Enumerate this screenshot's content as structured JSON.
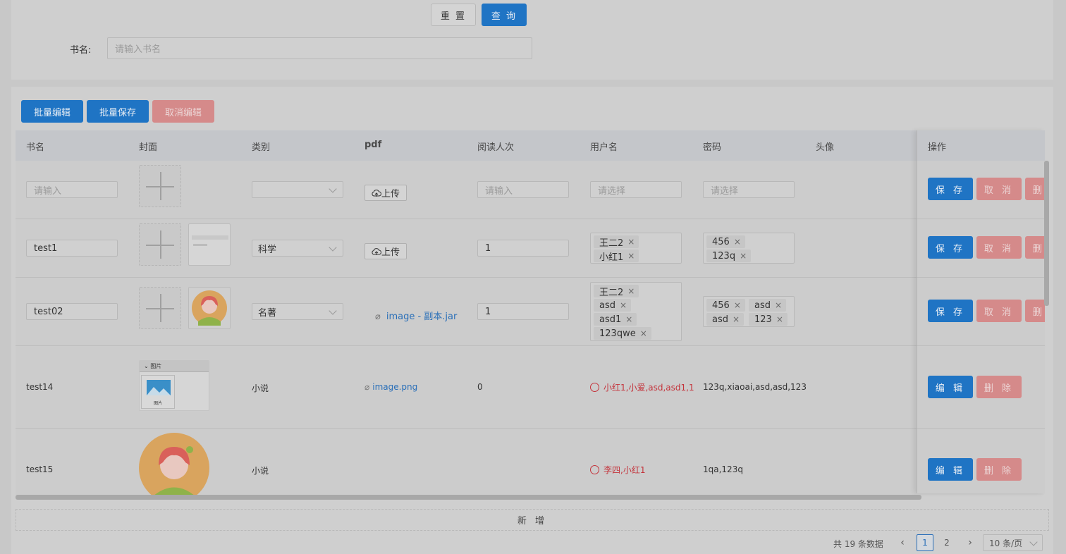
{
  "search": {
    "reset_label": "重 置",
    "query_label": "查 询",
    "book_name_label": "书名:",
    "book_name_placeholder": "请输入书名"
  },
  "toolbar": {
    "batch_edit": "批量编辑",
    "batch_save": "批量保存",
    "cancel_edit": "取消编辑"
  },
  "table": {
    "columns": [
      "书名",
      "封面",
      "类别",
      "pdf",
      "阅读人次",
      "用户名",
      "密码",
      "头像",
      "操作"
    ],
    "new_row": {
      "name_placeholder": "请输入",
      "upload_label": "上传",
      "reads_placeholder": "请输入",
      "user_placeholder": "请选择",
      "pwd_placeholder": "请选择"
    },
    "rows": [
      {
        "name": "test1",
        "category": "科学",
        "upload_label": "上传",
        "reads": "1",
        "users": [
          "王二2",
          "小红1"
        ],
        "passwords": [
          "456",
          "123q"
        ]
      },
      {
        "name": "test02",
        "category": "名著",
        "pdf": "image - 副本.jar",
        "reads": "1",
        "users": [
          "王二2",
          "asd",
          "asd1",
          "123qwe"
        ],
        "passwords": [
          "456",
          "asd",
          "asd",
          "123"
        ]
      },
      {
        "name": "test14",
        "cover_caption": "图片",
        "cover_caption2": "图片",
        "category": "小说",
        "pdf": "image.png",
        "reads": "0",
        "users": "小红1,小爱,asd,asd1,1",
        "passwords": "123q,xiaoai,asd,asd,123"
      },
      {
        "name": "test15",
        "category": "小说",
        "users": "李四,小红1",
        "passwords": "1qa,123q"
      }
    ],
    "actions": {
      "save": "保 存",
      "cancel": "取 消",
      "delete": "删 除",
      "edit": "编 辑"
    },
    "add_label": "新 增"
  },
  "pagination": {
    "total": "共 19 条数据",
    "pages": [
      "1",
      "2"
    ],
    "page_size": "10 条/页"
  },
  "colors": {
    "primary": "#1f74c4",
    "danger": "#d58a8a",
    "red_text": "#c4333b",
    "link": "#2a6fb8"
  }
}
